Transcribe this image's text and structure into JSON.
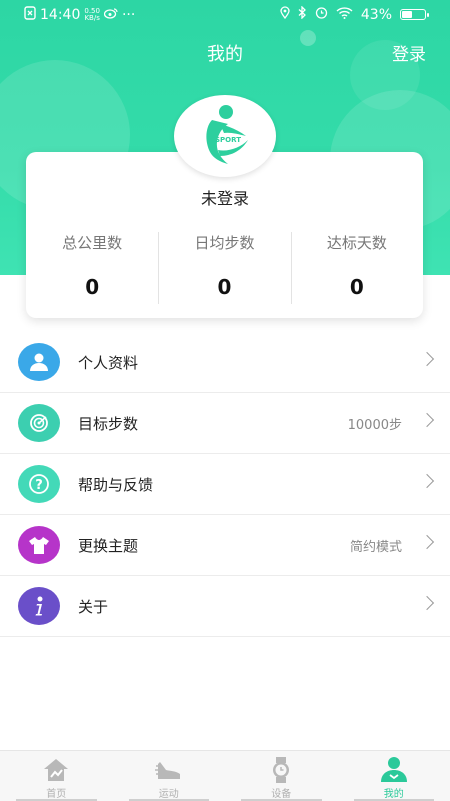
{
  "status_bar": {
    "time": "14:40",
    "speed_value": "0.50",
    "speed_unit": "KB/s",
    "dots": "···",
    "battery_pct": "43%"
  },
  "header": {
    "title": "我的",
    "login": "登录"
  },
  "profile": {
    "username": "未登录",
    "logo_text": "SPORT"
  },
  "stats": [
    {
      "label": "总公里数",
      "value": "0"
    },
    {
      "label": "日均步数",
      "value": "0"
    },
    {
      "label": "达标天数",
      "value": "0"
    }
  ],
  "menu": [
    {
      "label": "个人资料",
      "value": "",
      "icon": "person-icon",
      "color": "#3aa8e8"
    },
    {
      "label": "目标步数",
      "value": "10000步",
      "icon": "target-icon",
      "color": "#3ccfb0"
    },
    {
      "label": "帮助与反馈",
      "value": "",
      "icon": "question-icon",
      "color": "#43d9b8"
    },
    {
      "label": "更换主题",
      "value": "简约模式",
      "icon": "shirt-icon",
      "color": "#b634c9"
    },
    {
      "label": "关于",
      "value": "",
      "icon": "info-icon",
      "color": "#6a4fc9"
    }
  ],
  "tabs": [
    {
      "label": "首页",
      "icon": "home-icon"
    },
    {
      "label": "运动",
      "icon": "shoe-icon"
    },
    {
      "label": "设备",
      "icon": "watch-icon"
    },
    {
      "label": "我的",
      "icon": "profile-icon",
      "active": true
    }
  ],
  "colors": {
    "accent": "#2dd6a4",
    "active_tab": "#2bc99a"
  }
}
